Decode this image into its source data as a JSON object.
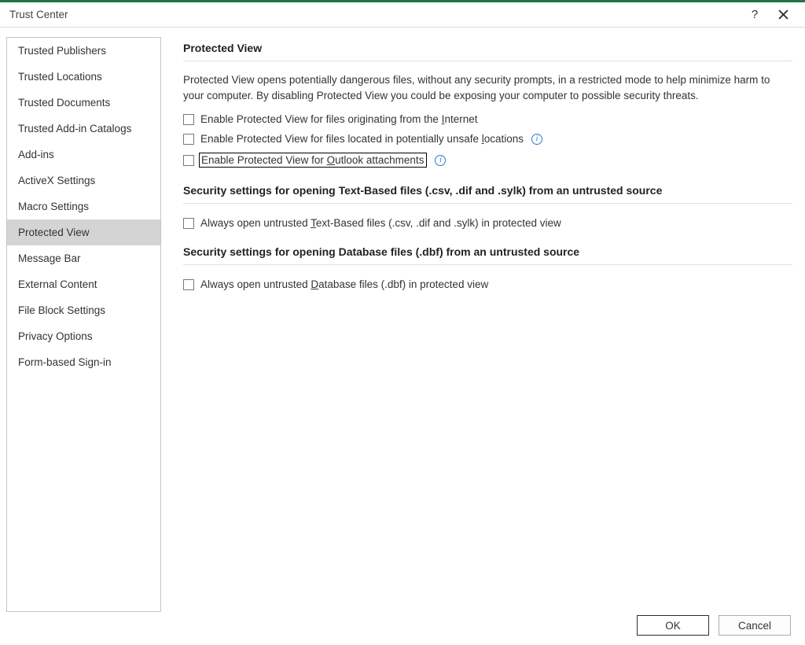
{
  "window": {
    "title": "Trust Center"
  },
  "sidebar": {
    "items": [
      "Trusted Publishers",
      "Trusted Locations",
      "Trusted Documents",
      "Trusted Add-in Catalogs",
      "Add-ins",
      "ActiveX Settings",
      "Macro Settings",
      "Protected View",
      "Message Bar",
      "External Content",
      "File Block Settings",
      "Privacy Options",
      "Form-based Sign-in"
    ],
    "selected_index": 7
  },
  "main": {
    "section1": {
      "heading": "Protected View",
      "desc": "Protected View opens potentially dangerous files, without any security prompts, in a restricted mode to help minimize harm to your computer. By disabling Protected View you could be exposing your computer to possible security threats.",
      "opt1": {
        "pre": "Enable Protected View for files originating from the ",
        "mn": "I",
        "post": "nternet",
        "checked": false,
        "info": false
      },
      "opt2": {
        "pre": "Enable Protected View for files located in potentially unsafe ",
        "mn": "l",
        "post": "ocations",
        "checked": false,
        "info": true
      },
      "opt3": {
        "pre": "Enable Protected View for ",
        "mn": "O",
        "post": "utlook attachments",
        "checked": false,
        "info": true,
        "highlighted": true
      }
    },
    "section2": {
      "heading": "Security settings for opening Text-Based files (.csv, .dif and .sylk) from an untrusted source",
      "opt1": {
        "pre": "Always open untrusted ",
        "mn": "T",
        "post": "ext-Based files (.csv, .dif and .sylk) in protected view",
        "checked": false
      }
    },
    "section3": {
      "heading": "Security settings for opening Database files (.dbf) from an untrusted source",
      "opt1": {
        "pre": "Always open untrusted ",
        "mn": "D",
        "post": "atabase files (.dbf) in protected view",
        "checked": false
      }
    }
  },
  "footer": {
    "ok": "OK",
    "cancel": "Cancel"
  },
  "colors": {
    "accent": "#217346",
    "info_icon": "#2e77d0"
  }
}
